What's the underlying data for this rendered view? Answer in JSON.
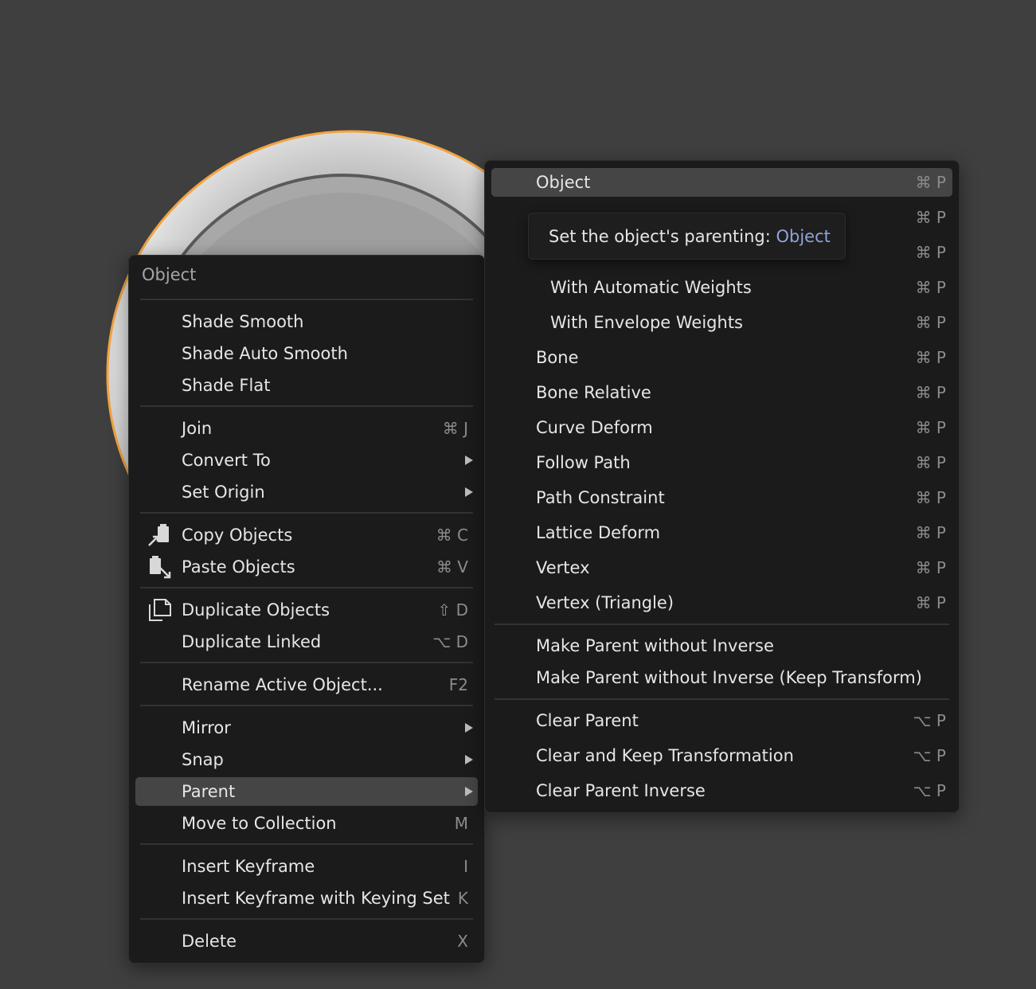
{
  "colors": {
    "background": "#3f3f3f",
    "menu_bg": "#1b1b1b",
    "active_row": "#454545",
    "object_outline": "#f2a342",
    "tooltip_accent": "#8ea5d8"
  },
  "object_menu": {
    "title": "Object",
    "items": [
      {
        "label": "Shade Smooth"
      },
      {
        "label": "Shade Auto Smooth"
      },
      {
        "label": "Shade Flat"
      },
      {
        "label": "Join",
        "shortcut": "⌘ J"
      },
      {
        "label": "Convert To",
        "submenu": true
      },
      {
        "label": "Set Origin",
        "submenu": true
      },
      {
        "label": "Copy Objects",
        "shortcut": "⌘ C",
        "icon": "copy-buffer-icon"
      },
      {
        "label": "Paste Objects",
        "shortcut": "⌘ V",
        "icon": "paste-buffer-icon"
      },
      {
        "label": "Duplicate Objects",
        "shortcut": "⇧ D",
        "icon": "duplicate-icon"
      },
      {
        "label": "Duplicate Linked",
        "shortcut": "⌥ D"
      },
      {
        "label": "Rename Active Object...",
        "shortcut": "F2"
      },
      {
        "label": "Mirror",
        "submenu": true
      },
      {
        "label": "Snap",
        "submenu": true
      },
      {
        "label": "Parent",
        "submenu": true,
        "active": true
      },
      {
        "label": "Move to Collection",
        "shortcut": "M"
      },
      {
        "label": "Insert Keyframe",
        "shortcut": "I"
      },
      {
        "label": "Insert Keyframe with Keying Set",
        "shortcut": "K"
      },
      {
        "label": "Delete",
        "shortcut": "X"
      }
    ]
  },
  "parent_menu": {
    "items": [
      {
        "label": "Object",
        "shortcut": "⌘ P",
        "active": true
      },
      {
        "label": "",
        "shortcut": "⌘ P"
      },
      {
        "label": "",
        "shortcut": "⌘ P"
      },
      {
        "label": "With Automatic Weights",
        "shortcut": "⌘ P"
      },
      {
        "label": "With Envelope Weights",
        "shortcut": "⌘ P"
      },
      {
        "label": "Bone",
        "shortcut": "⌘ P"
      },
      {
        "label": "Bone Relative",
        "shortcut": "⌘ P"
      },
      {
        "label": "Curve Deform",
        "shortcut": "⌘ P"
      },
      {
        "label": "Follow Path",
        "shortcut": "⌘ P"
      },
      {
        "label": "Path Constraint",
        "shortcut": "⌘ P"
      },
      {
        "label": "Lattice Deform",
        "shortcut": "⌘ P"
      },
      {
        "label": "Vertex",
        "shortcut": "⌘ P"
      },
      {
        "label": "Vertex (Triangle)",
        "shortcut": "⌘ P"
      },
      {
        "label": "Make Parent without Inverse"
      },
      {
        "label": "Make Parent without Inverse (Keep Transform)"
      },
      {
        "label": "Clear Parent",
        "shortcut": "⌥ P"
      },
      {
        "label": "Clear and Keep Transformation",
        "shortcut": "⌥ P"
      },
      {
        "label": "Clear Parent Inverse",
        "shortcut": "⌥ P"
      }
    ]
  },
  "tooltip": {
    "text": "Set the object's parenting: ",
    "highlight": "Object"
  }
}
